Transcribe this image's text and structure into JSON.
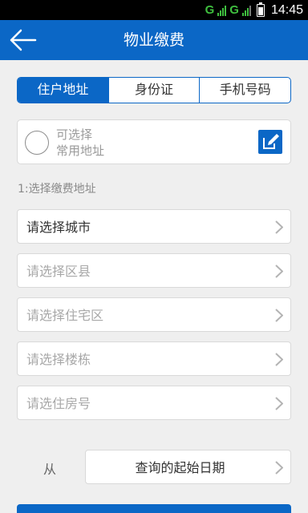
{
  "status_bar": {
    "network_1": "G",
    "network_2": "G",
    "time": "14:45"
  },
  "header": {
    "title": "物业缴费",
    "back_icon": "arrow-left-icon"
  },
  "tabs": [
    {
      "label": "住户地址",
      "active": true
    },
    {
      "label": "身份证",
      "active": false
    },
    {
      "label": "手机号码",
      "active": false
    }
  ],
  "common_address": {
    "line1": "可选择",
    "line2": "常用地址",
    "edit_icon": "edit-icon"
  },
  "section_label": "1:选择缴费地址",
  "address_selects": [
    {
      "label": "请选择城市",
      "placeholder": false
    },
    {
      "label": "请选择区县",
      "placeholder": true
    },
    {
      "label": "请选择住宅区",
      "placeholder": true
    },
    {
      "label": "请选择楼栋",
      "placeholder": true
    },
    {
      "label": "请选住房号",
      "placeholder": true
    }
  ],
  "date": {
    "from_label": "从",
    "start_placeholder": "查询的起始日期"
  },
  "colors": {
    "primary": "#0b67c6",
    "background": "#efefef"
  }
}
